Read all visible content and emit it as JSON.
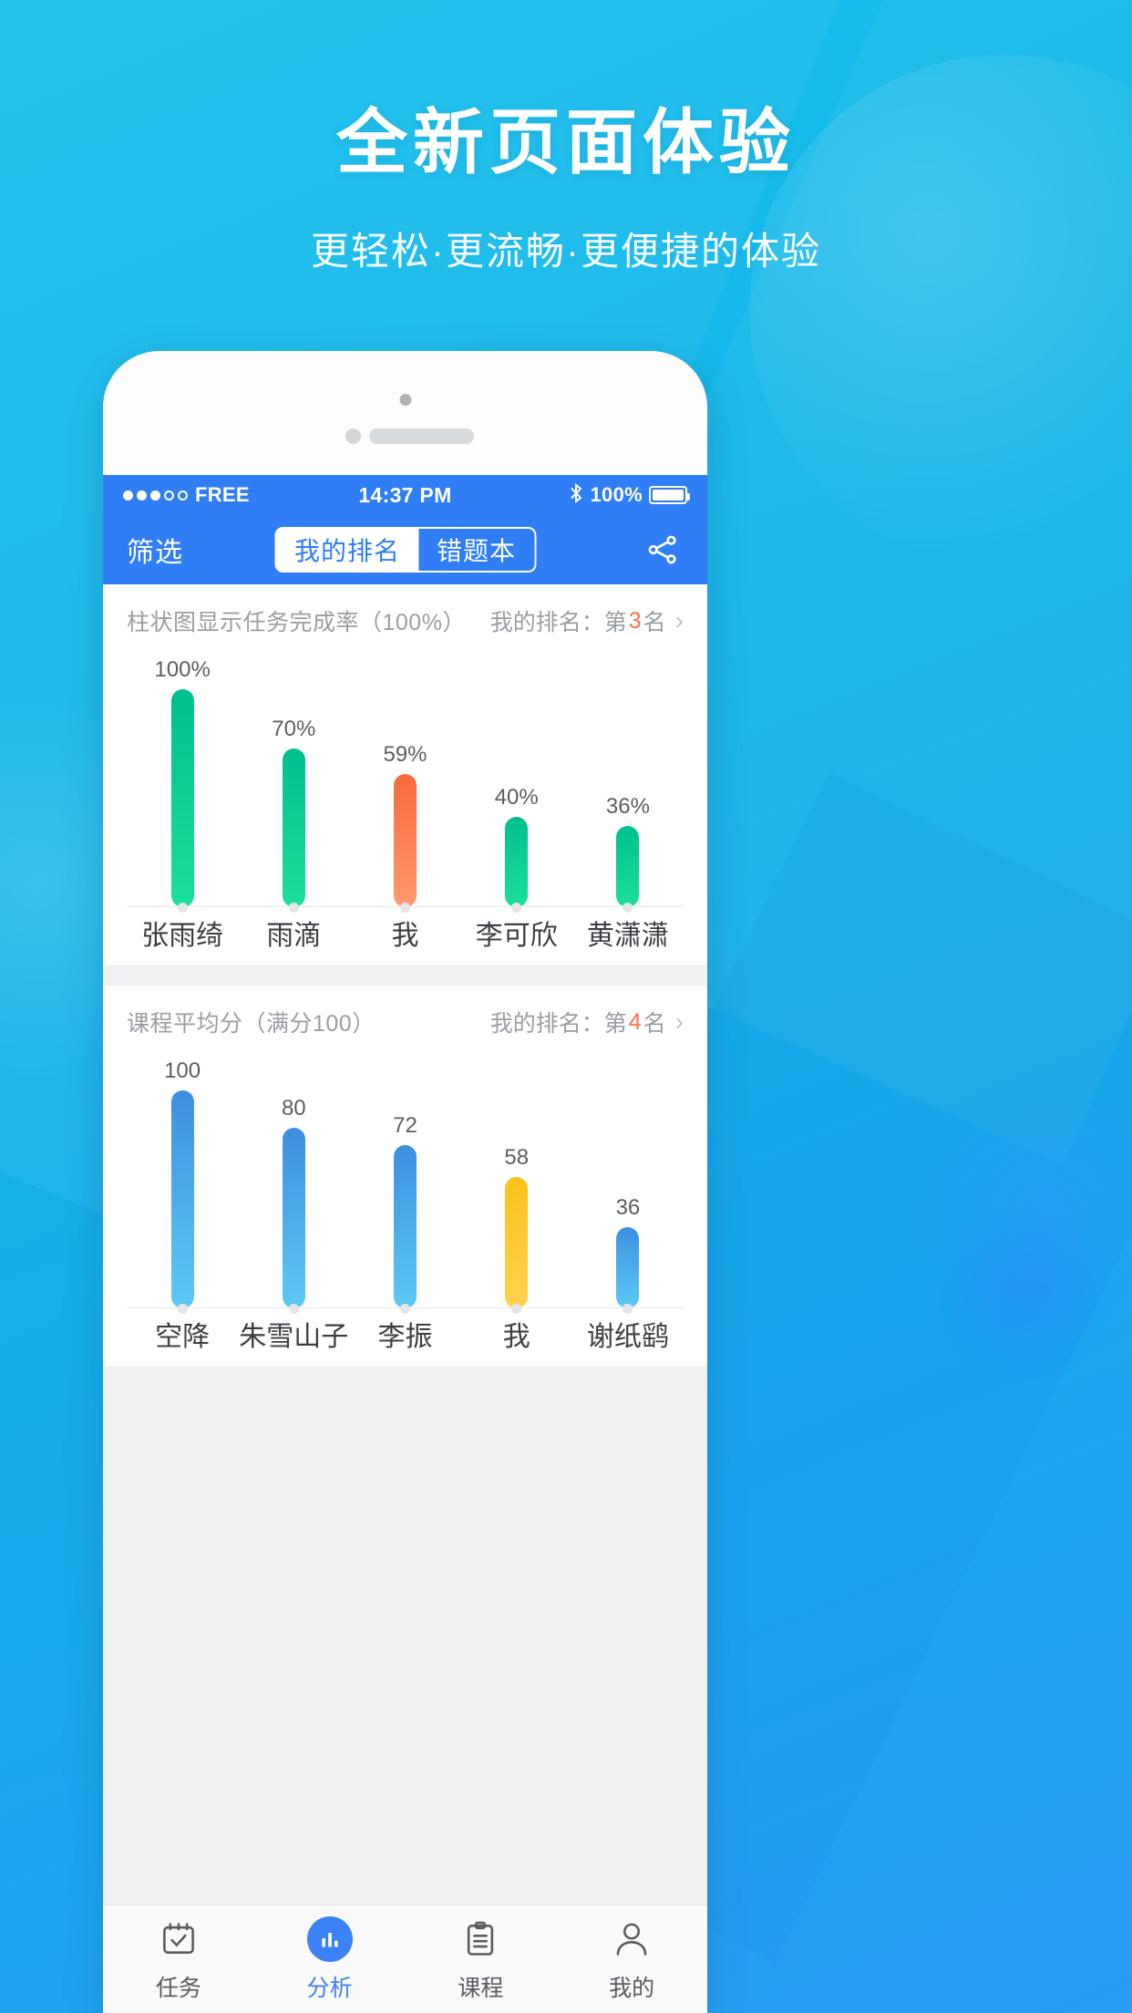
{
  "promo": {
    "title": "全新页面体验",
    "subtitle": "更轻松·更流畅·更便捷的体验"
  },
  "statusbar": {
    "carrier": "FREE",
    "time": "14:37 PM",
    "bluetooth_icon": "bluetooth-icon",
    "battery_percent": "100%"
  },
  "navbar": {
    "filter_label": "筛选",
    "segments": [
      {
        "label": "我的排名",
        "active": true
      },
      {
        "label": "错题本",
        "active": false
      }
    ],
    "share_icon": "share-icon"
  },
  "cards": [
    {
      "title": "柱状图显示任务完成率（100%）",
      "rank_prefix": "我的排名：第",
      "rank_num": "3",
      "rank_suffix": "名",
      "chevron": "›"
    },
    {
      "title": "课程平均分（满分100）",
      "rank_prefix": "我的排名：第",
      "rank_num": "4",
      "rank_suffix": "名",
      "chevron": "›"
    }
  ],
  "tabbar": {
    "items": [
      {
        "label": "任务",
        "icon": "calendar-check-icon",
        "active": false
      },
      {
        "label": "分析",
        "icon": "bar-chart-icon",
        "active": true
      },
      {
        "label": "课程",
        "icon": "clipboard-list-icon",
        "active": false
      },
      {
        "label": "我的",
        "icon": "user-icon",
        "active": false
      }
    ]
  },
  "colors": {
    "brand_blue": "#2f7ef5",
    "accent_orange": "#ff7043",
    "bar_green_top": "#00bf8f",
    "bar_green_bottom": "#1ae09a",
    "bar_orange_top": "#fa6a3c",
    "bar_orange_bottom": "#ff9a6e",
    "bar_blue_top": "#3d8fe0",
    "bar_blue_bottom": "#5ccaf5",
    "bar_amber": "#fcc21b",
    "hero_cyan": "#12b5e5"
  },
  "chart_data": [
    {
      "type": "bar",
      "title": "柱状图显示任务完成率（100%）",
      "xlabel": "",
      "ylabel": "",
      "ylim": [
        0,
        100
      ],
      "unit": "%",
      "grid": false,
      "legend": "none",
      "categories": [
        "张雨绮",
        "雨滴",
        "我",
        "李可欣",
        "黄潇潇"
      ],
      "values": [
        100,
        70,
        59,
        40,
        36
      ],
      "labels": [
        "100%",
        "70%",
        "59%",
        "40%",
        "36%"
      ],
      "highlight_index": 2,
      "bar_colors": [
        "green",
        "green",
        "orange",
        "green",
        "green"
      ]
    },
    {
      "type": "bar",
      "title": "课程平均分（满分100）",
      "xlabel": "",
      "ylabel": "",
      "ylim": [
        0,
        100
      ],
      "unit": "",
      "grid": false,
      "legend": "none",
      "categories": [
        "空降",
        "朱雪山子",
        "李振",
        "我",
        "谢纸鹞"
      ],
      "values": [
        100,
        80,
        72,
        58,
        36
      ],
      "labels": [
        "100",
        "80",
        "72",
        "58",
        "36"
      ],
      "highlight_index": 3,
      "bar_colors": [
        "blue",
        "blue",
        "blue",
        "amber",
        "blue"
      ]
    }
  ]
}
